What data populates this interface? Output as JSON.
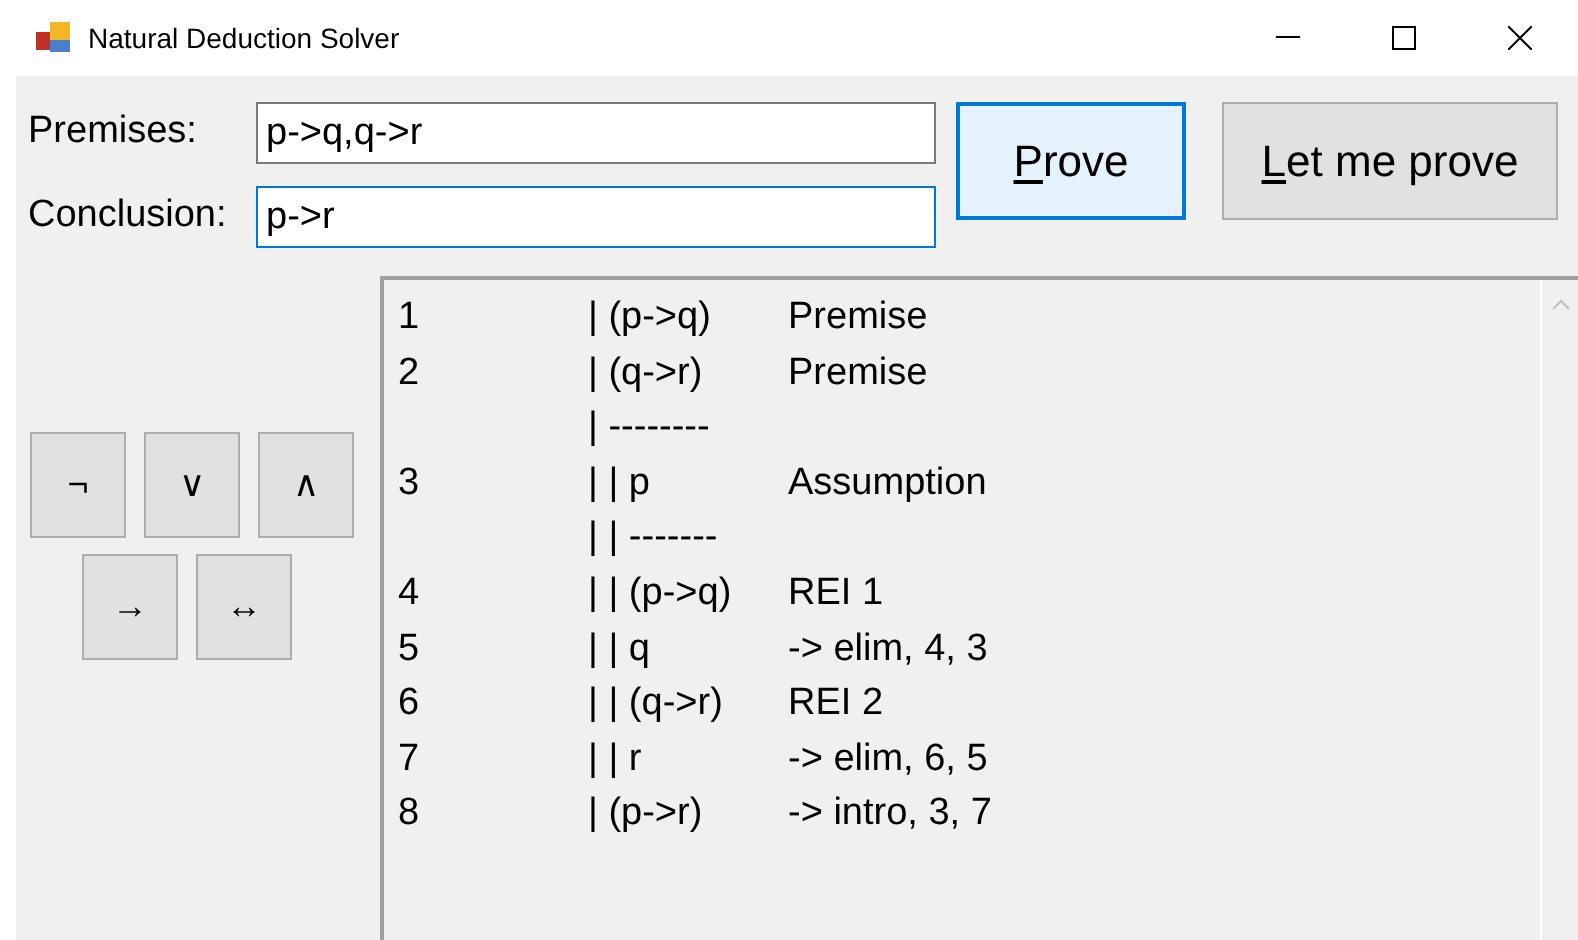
{
  "window": {
    "title": "Natural Deduction Solver"
  },
  "fields": [
    {
      "label": "Premises:",
      "value": "p->q,q->r",
      "focused": false
    },
    {
      "label": "Conclusion:",
      "value": "p->r",
      "focused": true
    }
  ],
  "buttons": [
    {
      "label": "Prove",
      "mnemonic_underlined": true,
      "focused": true
    },
    {
      "label": "Let me prove",
      "mnemonic_underlined": true,
      "focused": false
    }
  ],
  "operators": [
    [
      "¬",
      "∨",
      "∧"
    ],
    [
      "→",
      "↔"
    ]
  ],
  "proof": [
    {
      "kind": "line",
      "number": "1",
      "formula": "| (p->q)",
      "rule": "Premise"
    },
    {
      "kind": "line",
      "number": "2",
      "formula": "| (q->r)",
      "rule": "Premise"
    },
    {
      "kind": "separator",
      "formula": "| --------"
    },
    {
      "kind": "line",
      "number": "3",
      "formula": "| | p",
      "rule": "Assumption"
    },
    {
      "kind": "separator",
      "formula": "| | -------"
    },
    {
      "kind": "line",
      "number": "4",
      "formula": "| | (p->q)",
      "rule": "REI 1"
    },
    {
      "kind": "line",
      "number": "5",
      "formula": "| | q",
      "rule": "-> elim, 4, 3"
    },
    {
      "kind": "line",
      "number": "6",
      "formula": "| | (q->r)",
      "rule": "REI 2"
    },
    {
      "kind": "line",
      "number": "7",
      "formula": "| | r",
      "rule": "-> elim, 6, 5"
    },
    {
      "kind": "line",
      "number": "8",
      "formula": "| (p->r)",
      "rule": "-> intro, 3, 7"
    }
  ]
}
